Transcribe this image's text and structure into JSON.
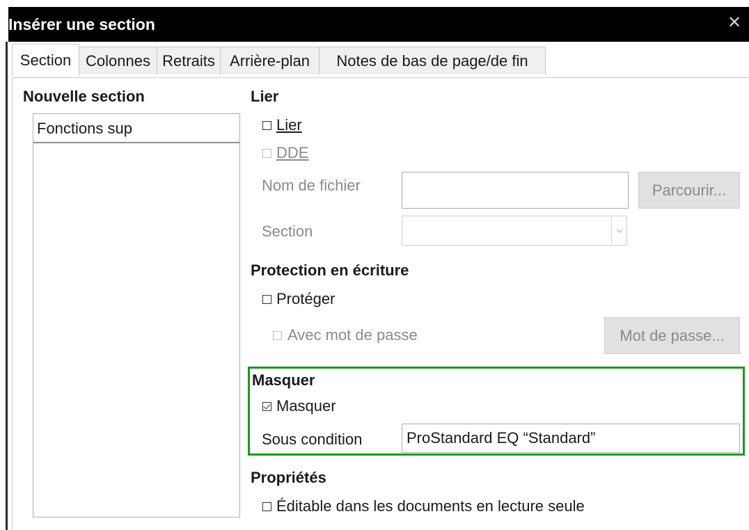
{
  "window": {
    "title": "Insérer une section",
    "close_label": "✕"
  },
  "tabs": [
    {
      "label": "Section",
      "active": true
    },
    {
      "label": "Colonnes",
      "active": false
    },
    {
      "label": "Retraits",
      "active": false
    },
    {
      "label": "Arrière-plan",
      "active": false
    },
    {
      "label": "Notes de bas de page/de fin",
      "active": false
    }
  ],
  "new_section": {
    "heading": "Nouvelle section",
    "name_value": "Fonctions sup"
  },
  "link": {
    "heading": "Lier",
    "link_checkbox": {
      "label": "Lier",
      "checked": false
    },
    "dde_checkbox": {
      "label": "DDE",
      "checked": false,
      "disabled": true
    },
    "filename_label": "Nom de fichier",
    "filename_value": "",
    "browse_button": "Parcourir...",
    "section_label": "Section",
    "section_value": ""
  },
  "write_protection": {
    "heading": "Protection en écriture",
    "protect_checkbox": {
      "label": "Protéger",
      "checked": false
    },
    "password_checkbox": {
      "label": "Avec mot de passe",
      "checked": false,
      "disabled": true
    },
    "password_button": "Mot de passe..."
  },
  "hide": {
    "heading": "Masquer",
    "hide_checkbox": {
      "label": "Masquer",
      "checked": true
    },
    "condition_label": "Sous condition",
    "condition_value": "ProStandard EQ “Standard”"
  },
  "properties": {
    "heading": "Propriétés",
    "editable_checkbox": {
      "label": "Éditable dans les documents en lecture seule",
      "checked": false
    }
  },
  "colors": {
    "titlebar": "#000000",
    "highlight": "#1a9a1a",
    "disabled_text": "#8a8a8a"
  }
}
